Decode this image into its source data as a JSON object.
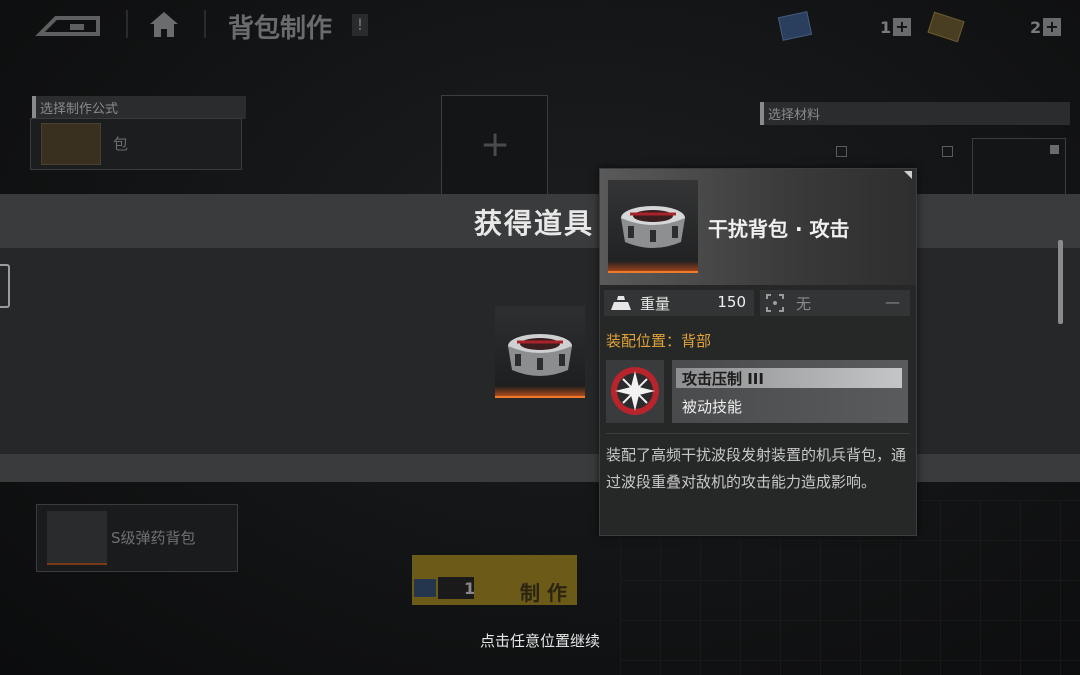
{
  "topbar": {
    "title": "背包制作",
    "alert_mark": "!",
    "resource_1_count": "1",
    "resource_2_count": "2"
  },
  "left_panel": {
    "formula_tag": "选择制作公式",
    "formula_item_text": "包",
    "ammo_pack_label": "S级弹药背包"
  },
  "right_panel": {
    "material_tag": "选择材料"
  },
  "craft": {
    "quantity": "1",
    "button_label": "制 作"
  },
  "banner": {
    "title": "获得道具"
  },
  "tooltip": {
    "item_name": "干扰背包 · 攻击",
    "weight_label": "重量",
    "weight_value": "150",
    "slot_label": "无",
    "slot_value": "—",
    "equip_position": "装配位置：背部",
    "skill_name": "攻击压制 III",
    "skill_type": "被动技能",
    "description": "装配了高频干扰波段发射装置的机兵背包，通过波段重叠对敌机的攻击能力造成影响。"
  },
  "continue_hint": "点击任意位置继续",
  "colors": {
    "accent_orange": "#f07a2a",
    "equip_text": "#e0a33a",
    "skill_red": "#b8242c"
  }
}
